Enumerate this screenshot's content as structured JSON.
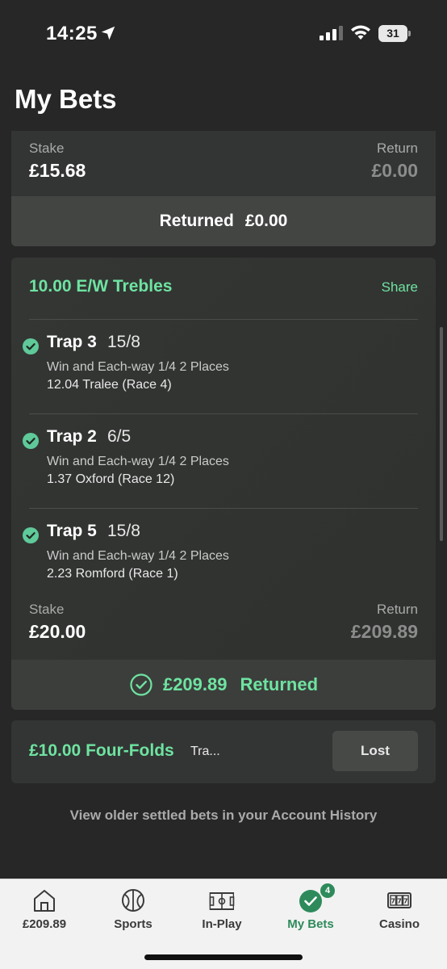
{
  "status_bar": {
    "time": "14:25",
    "battery": "31"
  },
  "page": {
    "title": "My Bets"
  },
  "colors": {
    "accent": "#6ee3a1",
    "active_tab": "#2e8a5b",
    "background": "#262726",
    "card": "#333534"
  },
  "bet1": {
    "stake_label": "Stake",
    "stake": "£15.68",
    "return_label": "Return",
    "return": "£0.00",
    "returned_label": "Returned",
    "returned_amount": "£0.00"
  },
  "bet2": {
    "title": "10.00 E/W Trebles",
    "share_label": "Share",
    "selections": [
      {
        "name": "Trap 3",
        "odds": "15/8",
        "market": "Win and Each-way 1/4 2 Places",
        "race": "12.04 Tralee (Race 4)"
      },
      {
        "name": "Trap 2",
        "odds": "6/5",
        "market": "Win and Each-way 1/4 2 Places",
        "race": "1.37 Oxford (Race 12)"
      },
      {
        "name": "Trap 5",
        "odds": "15/8",
        "market": "Win and Each-way 1/4 2 Places",
        "race": "2.23 Romford (Race 1)"
      }
    ],
    "stake_label": "Stake",
    "stake": "£20.00",
    "return_label": "Return",
    "return": "£209.89",
    "returned_amount": "£209.89",
    "returned_label": "Returned"
  },
  "bet3": {
    "title": "£10.00 Four-Folds",
    "subtitle": "Tra...",
    "result": "Lost"
  },
  "history_link": "View older settled bets in your Account History",
  "tabbar": {
    "tabs": [
      {
        "label": "£209.89",
        "icon": "home-icon"
      },
      {
        "label": "Sports",
        "icon": "football-icon"
      },
      {
        "label": "In-Play",
        "icon": "pitch-icon"
      },
      {
        "label": "My Bets",
        "icon": "check-circle-icon",
        "badge": "4",
        "active": true
      },
      {
        "label": "Casino",
        "icon": "slot-machine-icon"
      }
    ]
  }
}
